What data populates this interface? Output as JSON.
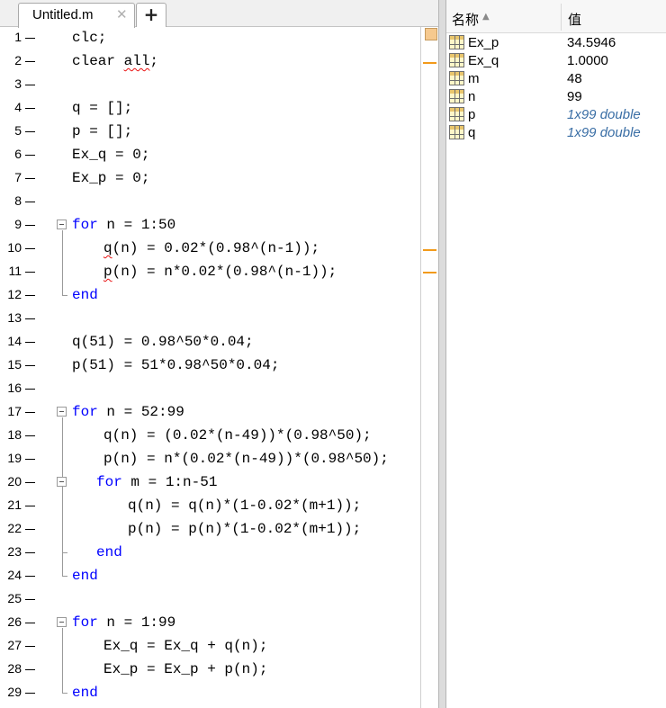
{
  "editor": {
    "tab_title": "Untitled.m",
    "tab_close_glyph": "✕",
    "add_tab_glyph": "+",
    "lines": [
      {
        "num": "1",
        "parts": [
          [
            "c",
            "clc;"
          ]
        ]
      },
      {
        "num": "2",
        "parts": [
          [
            "c",
            "clear "
          ],
          [
            "sq",
            "all"
          ],
          [
            "c",
            ";"
          ]
        ]
      },
      {
        "num": "3",
        "parts": []
      },
      {
        "num": "4",
        "parts": [
          [
            "c",
            "q = [];"
          ]
        ]
      },
      {
        "num": "5",
        "parts": [
          [
            "c",
            "p = [];"
          ]
        ]
      },
      {
        "num": "6",
        "parts": [
          [
            "c",
            "Ex_q = 0;"
          ]
        ]
      },
      {
        "num": "7",
        "parts": [
          [
            "c",
            "Ex_p = 0;"
          ]
        ]
      },
      {
        "num": "8",
        "parts": []
      },
      {
        "num": "9",
        "parts": [
          [
            "kw",
            "for"
          ],
          [
            "c",
            " n = 1:50"
          ]
        ]
      },
      {
        "num": "10",
        "parts": [
          [
            "sq",
            "q"
          ],
          [
            "c",
            "(n) = 0.02*(0.98^(n-1));"
          ]
        ]
      },
      {
        "num": "11",
        "parts": [
          [
            "sq",
            "p"
          ],
          [
            "c",
            "(n) = n*0.02*(0.98^(n-1));"
          ]
        ]
      },
      {
        "num": "12",
        "parts": [
          [
            "kw",
            "end"
          ]
        ]
      },
      {
        "num": "13",
        "parts": []
      },
      {
        "num": "14",
        "parts": [
          [
            "c",
            "q(51) = 0.98^50*0.04;"
          ]
        ]
      },
      {
        "num": "15",
        "parts": [
          [
            "c",
            "p(51) = 51*0.98^50*0.04;"
          ]
        ]
      },
      {
        "num": "16",
        "parts": []
      },
      {
        "num": "17",
        "parts": [
          [
            "kw",
            "for"
          ],
          [
            "c",
            " n = 52:99"
          ]
        ]
      },
      {
        "num": "18",
        "parts": [
          [
            "c",
            "q(n) = (0.02*(n-49))*(0.98^50);"
          ]
        ]
      },
      {
        "num": "19",
        "parts": [
          [
            "c",
            "p(n) = n*(0.02*(n-49))*(0.98^50);"
          ]
        ]
      },
      {
        "num": "20",
        "parts": [
          [
            "kw",
            "for"
          ],
          [
            "c",
            " m = 1:n-51"
          ]
        ]
      },
      {
        "num": "21",
        "parts": [
          [
            "c",
            "q(n) = q(n)*(1-0.02*(m+1));"
          ]
        ]
      },
      {
        "num": "22",
        "parts": [
          [
            "c",
            "p(n) = p(n)*(1-0.02*(m+1));"
          ]
        ]
      },
      {
        "num": "23",
        "parts": [
          [
            "kw",
            "end"
          ]
        ]
      },
      {
        "num": "24",
        "parts": [
          [
            "kw",
            "end"
          ]
        ]
      },
      {
        "num": "25",
        "parts": []
      },
      {
        "num": "26",
        "parts": [
          [
            "kw",
            "for"
          ],
          [
            "c",
            " n = 1:99"
          ]
        ]
      },
      {
        "num": "27",
        "parts": [
          [
            "c",
            "Ex_q = Ex_q + q(n);"
          ]
        ]
      },
      {
        "num": "28",
        "parts": [
          [
            "c",
            "Ex_p = Ex_p + p(n);"
          ]
        ]
      },
      {
        "num": "29",
        "parts": [
          [
            "kw",
            "end"
          ]
        ]
      }
    ]
  },
  "workspace": {
    "col_name": "名称",
    "col_value": "值",
    "sort_glyph": "▲",
    "variables": [
      {
        "name": "Ex_p",
        "value": "34.5946",
        "italic": false
      },
      {
        "name": "Ex_q",
        "value": "1.0000",
        "italic": false
      },
      {
        "name": "m",
        "value": "48",
        "italic": false
      },
      {
        "name": "n",
        "value": "99",
        "italic": false
      },
      {
        "name": "p",
        "value": "1x99 double",
        "italic": true
      },
      {
        "name": "q",
        "value": "1x99 double",
        "italic": true
      }
    ]
  }
}
